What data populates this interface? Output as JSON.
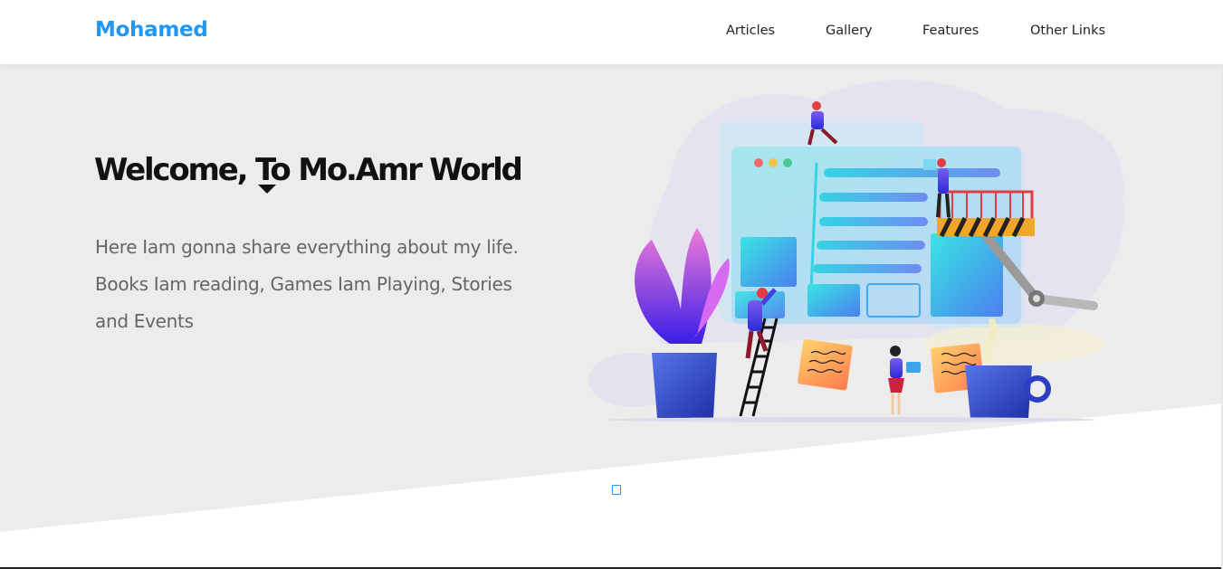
{
  "header": {
    "logo": "Mohamed",
    "nav": [
      "Articles",
      "Gallery",
      "Features",
      "Other Links"
    ]
  },
  "landing": {
    "title": "Welcome, To Mo.Amr World",
    "intro": "Here Iam gonna share everything about my life. Books Iam reading, Games Iam Playing, Stories and Events"
  },
  "colors": {
    "accent": "#2196f3",
    "landing_bg": "#ececec",
    "text_dark": "#111111",
    "text_muted": "#666666"
  }
}
